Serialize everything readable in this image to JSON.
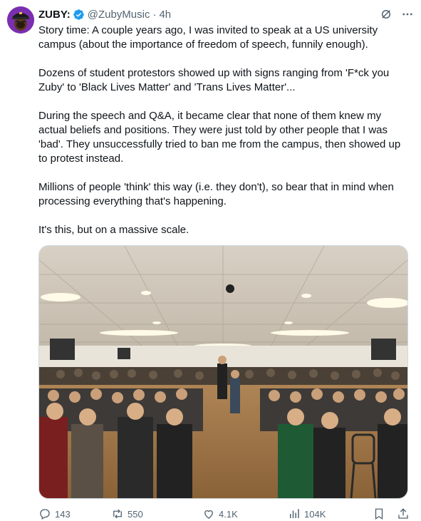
{
  "tweet": {
    "author_name": "ZUBY:",
    "handle": "@ZubyMusic",
    "separator": "·",
    "time": "4h",
    "text": "Story time: A couple years ago, I was invited to speak at a US university campus (about the importance of freedom of speech, funnily enough).\n\nDozens of student protestors showed up with signs ranging from 'F*ck you Zuby' to 'Black Lives Matter' and 'Trans Lives Matter'...\n\nDuring the speech and Q&A, it became clear that none of them knew my actual beliefs and positions. They were just told by other people that I was 'bad'. They unsuccessfully tried to ban me from the campus, then showed up to protest instead.\n\nMillions of people 'think' this way (i.e. they don't), so bear that in mind when processing everything that's happening.\n\nIt's this, but on a massive scale."
  },
  "stats": {
    "replies": "143",
    "reposts": "550",
    "likes": "4.1K",
    "views": "104K"
  },
  "icons": {
    "verified": "verified-badge-icon",
    "grok": "grok-icon",
    "more": "more-icon",
    "reply": "reply-icon",
    "repost": "repost-icon",
    "like": "heart-icon",
    "views": "views-icon",
    "bookmark": "bookmark-icon",
    "share": "share-icon"
  },
  "colors": {
    "verified": "#1d9bf0",
    "secondary_text": "#536471",
    "text": "#0f1419",
    "avatar_bg": "#7a2fb0"
  }
}
